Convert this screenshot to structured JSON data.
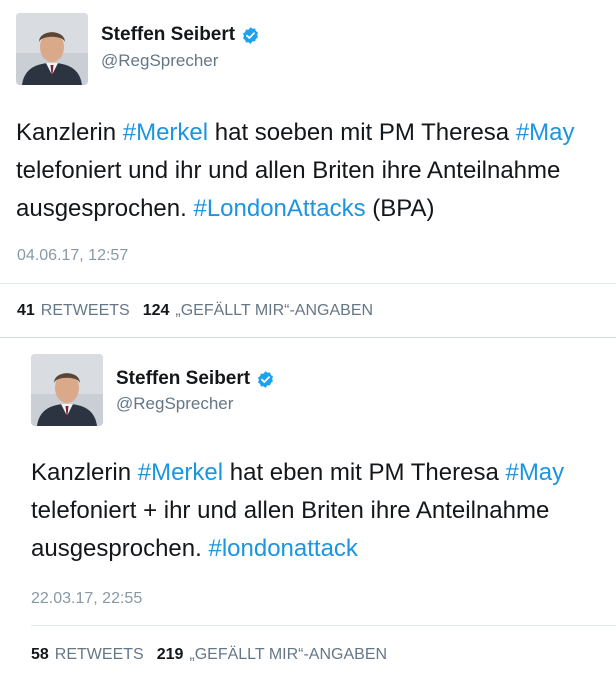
{
  "tweets": [
    {
      "name": "Steffen Seibert",
      "handle": "@RegSprecher",
      "lines": [
        [
          {
            "t": "Kanzlerin ",
            "tag": false
          },
          {
            "t": "#Merkel",
            "tag": true
          },
          {
            "t": " hat soeben mit PM Theresa ",
            "tag": false
          },
          {
            "t": "#May",
            "tag": true
          }
        ],
        [
          {
            "t": "telefoniert und ihr und allen Briten ihre Anteilnahme",
            "tag": false
          }
        ],
        [
          {
            "t": "ausgesprochen. ",
            "tag": false
          },
          {
            "t": "#LondonAttacks",
            "tag": true
          },
          {
            "t": " (BPA)",
            "tag": false
          }
        ]
      ],
      "date": "04.06.17, 12:57",
      "retweets_count": "41",
      "retweets_label": "RETWEETS",
      "likes_count": "124",
      "likes_label": "„GEFÄLLT MIR“-ANGABEN"
    },
    {
      "name": "Steffen Seibert",
      "handle": "@RegSprecher",
      "lines": [
        [
          {
            "t": "Kanzlerin ",
            "tag": false
          },
          {
            "t": "#Merkel",
            "tag": true
          },
          {
            "t": " hat eben mit PM Theresa ",
            "tag": false
          },
          {
            "t": "#May",
            "tag": true
          }
        ],
        [
          {
            "t": "telefoniert + ihr und allen Briten ihre Anteilnahme",
            "tag": false
          }
        ],
        [
          {
            "t": "ausgesprochen. ",
            "tag": false
          },
          {
            "t": "#londonattack",
            "tag": true
          }
        ]
      ],
      "date": "22.03.17, 22:55",
      "retweets_count": "58",
      "retweets_label": "RETWEETS",
      "likes_count": "219",
      "likes_label": "„GEFÄLLT MIR“-ANGABEN"
    }
  ],
  "colors": {
    "hashtag": "#1b95e0",
    "verified": "#1da1f2",
    "muted": "#657786"
  }
}
